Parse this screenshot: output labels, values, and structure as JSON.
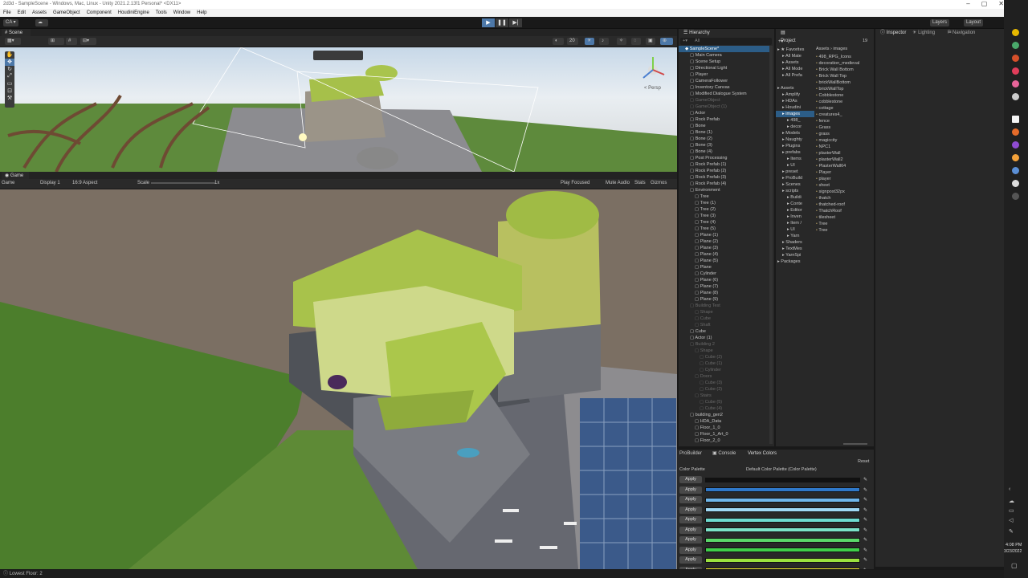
{
  "window": {
    "title": "2d3d - SampleScene - Windows, Mac, Linux - Unity 2021.2.13f1 Personal* <DX11>",
    "controls": [
      "–",
      "▢",
      "✕"
    ]
  },
  "menu": [
    "File",
    "Edit",
    "Assets",
    "GameObject",
    "Component",
    "HoudiniEngine",
    "Tools",
    "Window",
    "Help"
  ],
  "toolbar": {
    "account": "CA ▾",
    "layers": "Layers",
    "layout": "Layout"
  },
  "play": [
    "▶",
    "❚❚",
    "▶|"
  ],
  "scene": {
    "tab": "Scene",
    "persp": "< Persp",
    "mode_count": "20"
  },
  "game": {
    "tab": "Game",
    "mode": "Game",
    "display": "Display 1",
    "aspect": "16:9 Aspect",
    "scale_label": "Scale",
    "scale_value": "1x",
    "play_focused": "Play Focused",
    "mute": "Mute Audio",
    "stats": "Stats",
    "gizmos": "Gizmos"
  },
  "hierarchy": {
    "tab": "Hierarchy",
    "search": "All",
    "items": [
      {
        "t": "SampleScene*",
        "d": 0,
        "k": "sel"
      },
      {
        "t": "Main Camera",
        "d": 1
      },
      {
        "t": "Scene Setup",
        "d": 1
      },
      {
        "t": "Directional Light",
        "d": 1
      },
      {
        "t": "Player",
        "d": 1
      },
      {
        "t": "CameraFollower",
        "d": 1
      },
      {
        "t": "Inventory Canvas",
        "d": 1
      },
      {
        "t": "Modified Dialogue System",
        "d": 1
      },
      {
        "t": "GameObject",
        "d": 1,
        "k": "dim"
      },
      {
        "t": "GameObject (1)",
        "d": 1,
        "k": "dim"
      },
      {
        "t": "Actor",
        "d": 1
      },
      {
        "t": "Rock Prefab",
        "d": 1
      },
      {
        "t": "Bone",
        "d": 1
      },
      {
        "t": "Bone (1)",
        "d": 1
      },
      {
        "t": "Bone (2)",
        "d": 1
      },
      {
        "t": "Bone (3)",
        "d": 1
      },
      {
        "t": "Bone (4)",
        "d": 1
      },
      {
        "t": "Post Processing",
        "d": 1
      },
      {
        "t": "Rock Prefab (1)",
        "d": 1
      },
      {
        "t": "Rock Prefab (2)",
        "d": 1
      },
      {
        "t": "Rock Prefab (3)",
        "d": 1
      },
      {
        "t": "Rock Prefab (4)",
        "d": 1
      },
      {
        "t": "Environment",
        "d": 1
      },
      {
        "t": "Tree",
        "d": 2
      },
      {
        "t": "Tree (1)",
        "d": 2
      },
      {
        "t": "Tree (2)",
        "d": 2
      },
      {
        "t": "Tree (3)",
        "d": 2
      },
      {
        "t": "Tree (4)",
        "d": 2
      },
      {
        "t": "Tree (5)",
        "d": 2
      },
      {
        "t": "Plane (1)",
        "d": 2
      },
      {
        "t": "Plane (2)",
        "d": 2
      },
      {
        "t": "Plane (3)",
        "d": 2
      },
      {
        "t": "Plane (4)",
        "d": 2
      },
      {
        "t": "Plane (5)",
        "d": 2
      },
      {
        "t": "Plane",
        "d": 2
      },
      {
        "t": "Cylinder",
        "d": 2
      },
      {
        "t": "Plane (6)",
        "d": 2
      },
      {
        "t": "Plane (7)",
        "d": 2
      },
      {
        "t": "Plane (8)",
        "d": 2
      },
      {
        "t": "Plane (9)",
        "d": 2
      },
      {
        "t": "Building Test",
        "d": 1,
        "k": "dim"
      },
      {
        "t": "Shape",
        "d": 2,
        "k": "dim"
      },
      {
        "t": "Cube",
        "d": 2,
        "k": "dim"
      },
      {
        "t": "Shaft",
        "d": 2,
        "k": "dim"
      },
      {
        "t": "Cube",
        "d": 1
      },
      {
        "t": "Actor (1)",
        "d": 1
      },
      {
        "t": "Building 2",
        "d": 1,
        "k": "dim"
      },
      {
        "t": "Shape",
        "d": 2,
        "k": "dim"
      },
      {
        "t": "Cube (2)",
        "d": 3,
        "k": "dim"
      },
      {
        "t": "Cube (1)",
        "d": 3,
        "k": "dim"
      },
      {
        "t": "Cylinder",
        "d": 3,
        "k": "dim"
      },
      {
        "t": "Doors",
        "d": 2,
        "k": "dim"
      },
      {
        "t": "Cube (3)",
        "d": 3,
        "k": "dim"
      },
      {
        "t": "Cube (2)",
        "d": 3,
        "k": "dim"
      },
      {
        "t": "Stairs",
        "d": 2,
        "k": "dim"
      },
      {
        "t": "Cube (5)",
        "d": 3,
        "k": "dim"
      },
      {
        "t": "Cube (4)",
        "d": 3,
        "k": "dim"
      },
      {
        "t": "building_gen2",
        "d": 1
      },
      {
        "t": "HDA_Data",
        "d": 2
      },
      {
        "t": "Floor_1_0",
        "d": 2
      },
      {
        "t": "Floor_1_Art_0",
        "d": 2
      },
      {
        "t": "Floor_2_0",
        "d": 2
      },
      {
        "t": "Floor 2 Art 0",
        "d": 2
      }
    ]
  },
  "project": {
    "tab": "Project",
    "breadcrumb_root": "Assets",
    "breadcrumb_leaf": "images",
    "count": "19",
    "tree": [
      {
        "t": "★ Favorites",
        "d": 0
      },
      {
        "t": "All Mate",
        "d": 1
      },
      {
        "t": "Assets",
        "d": 1
      },
      {
        "t": "All Mode",
        "d": 1
      },
      {
        "t": "All Prefa",
        "d": 1
      },
      {
        "t": "",
        "d": 0
      },
      {
        "t": "Assets",
        "d": 0
      },
      {
        "t": "Amplify",
        "d": 1
      },
      {
        "t": "HDAs",
        "d": 1
      },
      {
        "t": "Houdini",
        "d": 1
      },
      {
        "t": "images",
        "d": 1,
        "k": "sel"
      },
      {
        "t": "498_",
        "d": 2
      },
      {
        "t": "decor",
        "d": 2
      },
      {
        "t": "Models",
        "d": 1
      },
      {
        "t": "Naughty",
        "d": 1
      },
      {
        "t": "Plugins",
        "d": 1
      },
      {
        "t": "prefabs",
        "d": 1
      },
      {
        "t": "Items",
        "d": 2
      },
      {
        "t": "UI",
        "d": 2
      },
      {
        "t": "preset",
        "d": 1
      },
      {
        "t": "ProBuild",
        "d": 1
      },
      {
        "t": "Scenes",
        "d": 1
      },
      {
        "t": "scripts",
        "d": 1
      },
      {
        "t": "Buildi",
        "d": 2
      },
      {
        "t": "Conte",
        "d": 2
      },
      {
        "t": "Editor",
        "d": 2
      },
      {
        "t": "Inven",
        "d": 2
      },
      {
        "t": "Item /",
        "d": 2
      },
      {
        "t": "UI",
        "d": 2
      },
      {
        "t": "Yarn",
        "d": 2
      },
      {
        "t": "Shaders",
        "d": 1
      },
      {
        "t": "TextMes",
        "d": 1
      },
      {
        "t": "YarnSpi",
        "d": 1
      },
      {
        "t": "Packages",
        "d": 0
      }
    ],
    "files": [
      "498_RPG_Icons",
      "decoration_medieval",
      "Brick Wall Bottom",
      "Brick Wall Top",
      "brickWallBottom",
      "brickWallTop",
      "Cobblestone",
      "cobblestone",
      "cottage",
      "creatures4_",
      "fence",
      "Grass",
      "grass",
      "magiccity",
      "NPC1",
      "plasterWall",
      "plasterWall2",
      "PlasterWall64",
      "Player",
      "player",
      "sheet",
      "signpost32px",
      "thatch",
      "thatched-roof",
      "ThatchRoof",
      "tilesheet",
      "Tree",
      "Tree"
    ]
  },
  "inspector": {
    "tabs": [
      "Inspector",
      "Lighting",
      "Navigation"
    ]
  },
  "vertex_colors": {
    "tabs": [
      "ProBuilder",
      "Console",
      "Vertex Colors"
    ],
    "reset": "Reset",
    "palette_label": "Color Palette",
    "palette_value": "Default Color Palette (Color Palette)",
    "apply_label": "Apply",
    "colors": [
      "#111111",
      "#2f78c8",
      "#6fb6ea",
      "#9fd8f4",
      "#6edbd0",
      "#7ce2c8",
      "#5bd86a",
      "#3fcf4a",
      "#9be23f",
      "#f4ee34",
      "#f5b533",
      "#f07c2a"
    ]
  },
  "status": {
    "text": "Lowest Floor: 2"
  },
  "taskbar": {
    "time": "4:08 PM",
    "date": "3/23/2022"
  }
}
